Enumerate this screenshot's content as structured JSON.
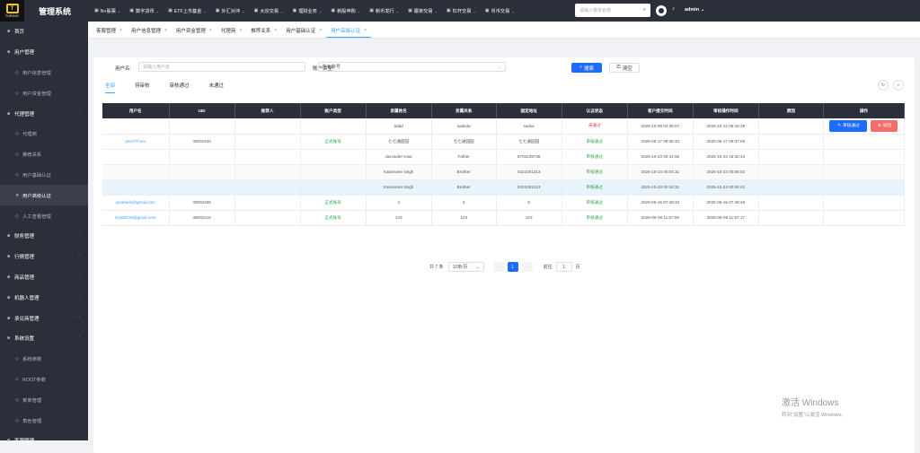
{
  "brand": {
    "logo_text": "TURING",
    "system_title": "管理系统"
  },
  "topnav": [
    {
      "label": "N+股票",
      "icon": "grid-icon"
    },
    {
      "label": "数字货币",
      "icon": "coin-icon"
    },
    {
      "label": "ETF上市基金",
      "icon": "fund-icon"
    },
    {
      "label": "外汇对冲",
      "icon": "exchange-icon"
    },
    {
      "label": "大宗交易",
      "icon": "trade-icon"
    },
    {
      "label": "理财业务",
      "icon": "finance-icon"
    },
    {
      "label": "新股申购",
      "icon": "ipo-icon"
    },
    {
      "label": "新币发行",
      "icon": "newcoin-icon"
    },
    {
      "label": "跟单交易",
      "icon": "follow-icon"
    },
    {
      "label": "杠杆交易",
      "icon": "leverage-icon"
    },
    {
      "label": "币币交易",
      "icon": "spot-icon"
    }
  ],
  "search": {
    "placeholder": "请输入菜单名称"
  },
  "user": {
    "name": "admin"
  },
  "sidebar": [
    {
      "label": "首页",
      "type": "top"
    },
    {
      "label": "用户管理",
      "type": "parent"
    },
    {
      "label": "用户信息管理",
      "type": "sub"
    },
    {
      "label": "用户资金管理",
      "type": "sub"
    },
    {
      "label": "代理管理",
      "type": "parent"
    },
    {
      "label": "代理商",
      "type": "sub"
    },
    {
      "label": "推荐关系",
      "type": "sub"
    },
    {
      "label": "用户基础认证",
      "type": "sub"
    },
    {
      "label": "用户高级认证",
      "type": "sub-active"
    },
    {
      "label": "人工查看管理",
      "type": "sub"
    },
    {
      "label": "财务管理",
      "type": "parent"
    },
    {
      "label": "行情管理",
      "type": "parent"
    },
    {
      "label": "商品管理",
      "type": "parent"
    },
    {
      "label": "机器人管理",
      "type": "parent"
    },
    {
      "label": "承兑商管理",
      "type": "parent"
    },
    {
      "label": "系统设置",
      "type": "parent"
    },
    {
      "label": "系统参数",
      "type": "sub"
    },
    {
      "label": "ROOT参数",
      "type": "sub"
    },
    {
      "label": "菜单管理",
      "type": "sub"
    },
    {
      "label": "角色管理",
      "type": "sub"
    },
    {
      "label": "客服管理",
      "type": "top"
    }
  ],
  "tabs": [
    {
      "label": "客服管理",
      "active": false
    },
    {
      "label": "用户信息管理",
      "active": false
    },
    {
      "label": "用户资金管理",
      "active": false
    },
    {
      "label": "代理商",
      "active": false
    },
    {
      "label": "推荐关系",
      "active": false
    },
    {
      "label": "用户基础认证",
      "active": false
    },
    {
      "label": "用户高级认证",
      "active": true
    }
  ],
  "filter": {
    "username_label": "用户名:",
    "username_placeholder": "请输入用户名",
    "account_type_label": "账户类型:",
    "account_type_value": "所有账号",
    "search_label": "搜索",
    "clear_label": "清空"
  },
  "subtabs": [
    "全部",
    "待审核",
    "审核通过",
    "未通过"
  ],
  "table": {
    "columns": [
      "用户名",
      "UID",
      "推荐人",
      "账户类型",
      "亲属姓名",
      "亲属关系",
      "固定地址",
      "认证状态",
      "客户提交时间",
      "审核操作时间",
      "原因",
      "操作"
    ],
    "rows": [
      [
        "",
        "",
        "",
        "",
        "ádád",
        "sadsda",
        "sadas",
        "未通过",
        "2025-10-09 04:35:07",
        "2025-10-12 08:18:35",
        "",
        ""
      ],
      [
        "yem77com",
        "40002440",
        "",
        "正式账号",
        "七七通园园",
        "七七通园园",
        "七七通园园",
        "审核通过",
        "2025-05-17 09:36:43",
        "2025-05-17 09:37:05",
        "",
        ""
      ],
      [
        "",
        "",
        "",
        "",
        "Jasvinder Kaur",
        "Father",
        "8700239735",
        "审核通过",
        "2025-10-23 00:44:56",
        "2025-10-23 18:30:34",
        "",
        ""
      ],
      [
        "",
        "",
        "",
        "",
        "Karanveer singh",
        "Brother",
        "0221001313",
        "审核通过",
        "2025-10-23 00:04:31",
        "2025-10-23 00:08:02",
        "",
        ""
      ],
      [
        "",
        "",
        "",
        "",
        "Karanveer singh",
        "Brother",
        "0221001313",
        "审核通过",
        "2025-10-23 00:04:31",
        "2025-10-23 00:08:42",
        "",
        ""
      ],
      [
        "juzabedo@gmail.com",
        "40002265",
        "",
        "正式账号",
        "4",
        "3",
        "6",
        "审核通过",
        "2025-06-15 07:49:33",
        "2025-06-15 07:49:46",
        "",
        ""
      ],
      [
        "Ilya92019@gmail.com",
        "40002216",
        "",
        "正式账号",
        "123",
        "123",
        "123",
        "审核通过",
        "2025-06-09 11:57:08",
        "2025-06-09 11:57:17",
        "",
        ""
      ]
    ],
    "approve_label": "审核通过",
    "reject_label": "驳回"
  },
  "pagination": {
    "total_label": "共 7 条",
    "page_size": "10条/页",
    "current_page": "1",
    "goto_label": "前往",
    "goto_value": "1",
    "page_suffix": "页"
  },
  "watermark": {
    "line1": "激活 Windows",
    "line2": "转到\"设置\"以激活 Windows。"
  },
  "colors": {
    "sidebar_bg": "#2b2f3a",
    "primary": "#1e6bff",
    "danger": "#f56c6c",
    "success": "#2fa54b",
    "fail": "#e53935"
  }
}
